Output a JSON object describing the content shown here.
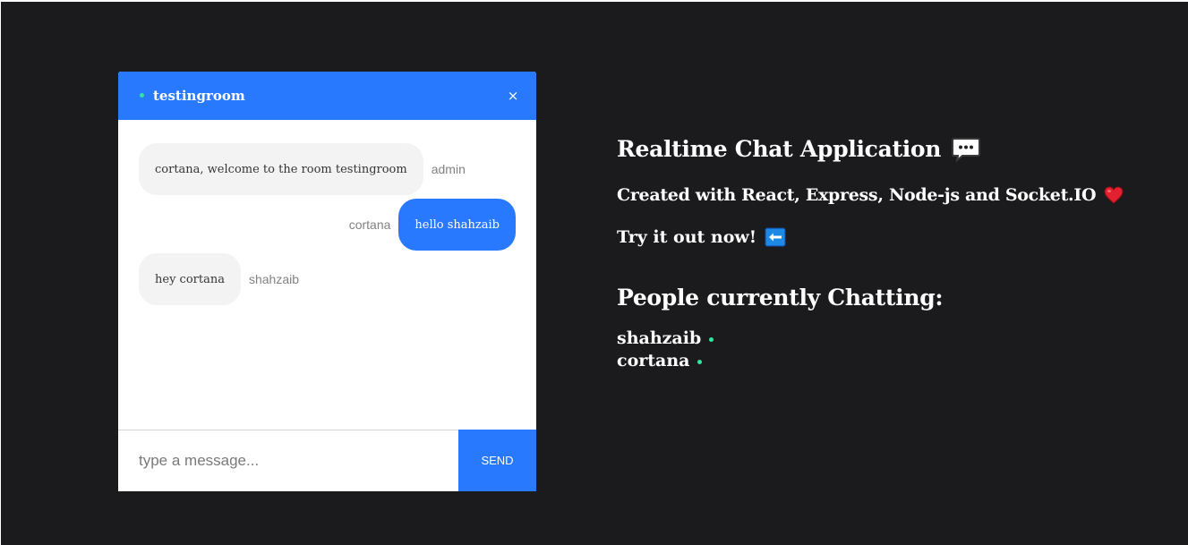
{
  "chat": {
    "room_name": "testingroom",
    "close_icon": "×",
    "messages": [
      {
        "text": "cortana, welcome to the room testingroom",
        "sender": "admin",
        "own": false
      },
      {
        "text": "hello shahzaib",
        "sender": "cortana",
        "own": true
      },
      {
        "text": "hey cortana",
        "sender": "shahzaib",
        "own": false
      }
    ],
    "input": {
      "value": "",
      "placeholder": "type a message..."
    },
    "send_label": "send"
  },
  "info": {
    "title": "Realtime Chat Application",
    "title_icon": "speech-balloon-icon",
    "subtitle": "Created with React, Express, Node-js and Socket.IO",
    "subtitle_icon": "heart-icon",
    "cta": "Try it out now!",
    "cta_icon": "left-arrow-icon",
    "people_heading": "People currently Chatting:",
    "people": [
      "shahzaib",
      "cortana"
    ]
  },
  "colors": {
    "background": "#1b1b1e",
    "accent": "#2979ff",
    "online": "#2ee6a0",
    "heart": "#e3202e"
  }
}
